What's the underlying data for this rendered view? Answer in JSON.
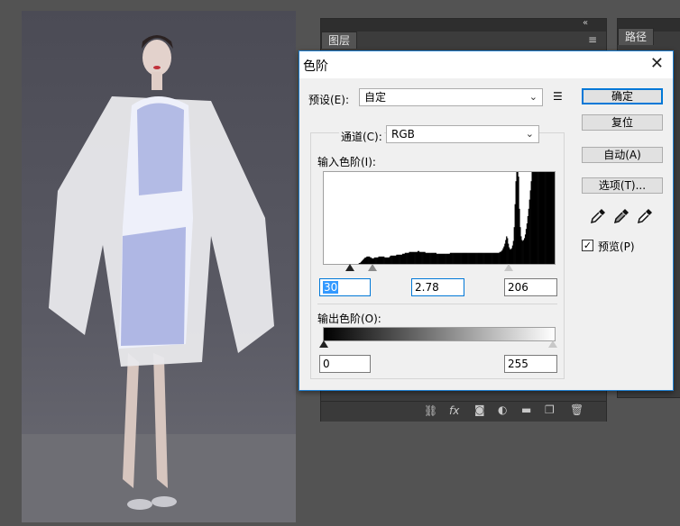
{
  "panels": {
    "layers_tab": "图层",
    "paths_tab": "路径",
    "collapse_icon": "double-chevron-left-icon",
    "menu_icon": "panel-menu-icon",
    "bottom_icons": [
      "link-icon",
      "fx-icon",
      "mask-icon",
      "adjustment-icon",
      "folder-icon",
      "new-layer-icon",
      "trash-icon"
    ],
    "fx_label": "fx"
  },
  "dialog": {
    "title": "色阶",
    "close": "✕",
    "preset_label": "预设(E):",
    "preset_value": "自定",
    "channel_label": "通道(C):",
    "channel_value": "RGB",
    "input_levels_label": "输入色阶(I):",
    "output_levels_label": "输出色阶(O):",
    "input": {
      "black": "30",
      "gamma": "2.78",
      "white": "206"
    },
    "output": {
      "black": "0",
      "white": "255"
    },
    "buttons": {
      "ok": "确定",
      "reset": "复位",
      "auto": "自动(A)",
      "options": "选项(T)..."
    },
    "preview_label": "预览(P)",
    "preview_checked": "✓",
    "eyedroppers": [
      "black-eyedropper-icon",
      "gray-eyedropper-icon",
      "white-eyedropper-icon"
    ],
    "accent": "#0078d7"
  },
  "histogram": {
    "channel": "RGB",
    "bins_0_255": [
      0,
      0,
      0,
      0,
      0,
      0,
      0,
      0,
      0,
      0,
      0,
      0,
      0,
      0,
      0,
      0,
      0,
      0,
      0,
      0,
      0,
      0,
      0,
      0,
      0,
      0,
      0,
      0,
      0,
      0,
      0,
      0,
      0,
      0,
      0,
      0,
      0,
      0,
      0,
      0,
      0,
      1,
      1,
      2,
      3,
      4,
      5,
      6,
      7,
      7,
      8,
      8,
      8,
      8,
      7,
      7,
      6,
      6,
      6,
      7,
      7,
      7,
      7,
      7,
      8,
      8,
      8,
      8,
      8,
      8,
      8,
      7,
      7,
      7,
      7,
      7,
      7,
      8,
      9,
      9,
      9,
      9,
      9,
      9,
      9,
      10,
      10,
      10,
      10,
      10,
      10,
      10,
      11,
      11,
      11,
      12,
      12,
      12,
      12,
      12,
      13,
      13,
      13,
      13,
      13,
      13,
      13,
      13,
      13,
      13,
      14,
      14,
      13,
      13,
      13,
      13,
      13,
      13,
      13,
      12,
      12,
      12,
      12,
      12,
      12,
      12,
      12,
      12,
      12,
      12,
      12,
      12,
      11,
      11,
      11,
      11,
      11,
      11,
      11,
      11,
      11,
      11,
      11,
      11,
      11,
      11,
      11,
      11,
      12,
      12,
      12,
      12,
      12,
      12,
      12,
      12,
      12,
      12,
      12,
      12,
      12,
      12,
      12,
      12,
      12,
      12,
      12,
      12,
      12,
      12,
      12,
      12,
      12,
      12,
      12,
      12,
      12,
      12,
      12,
      12,
      12,
      12,
      12,
      12,
      12,
      12,
      12,
      12,
      12,
      12,
      12,
      12,
      12,
      12,
      12,
      12,
      12,
      12,
      12,
      12,
      12,
      12,
      12,
      12,
      12,
      12,
      13,
      13,
      14,
      15,
      17,
      19,
      22,
      26,
      30,
      28,
      22,
      18,
      16,
      16,
      17,
      20,
      25,
      40,
      65,
      90,
      100,
      100,
      95,
      60,
      40,
      30,
      26,
      25,
      26,
      28,
      32,
      38,
      44,
      52,
      60,
      70,
      80,
      90,
      100,
      100,
      100,
      100,
      100,
      100,
      100,
      100,
      100,
      100,
      100,
      100,
      100,
      100,
      100,
      100,
      100,
      100,
      100,
      100,
      100,
      100,
      100,
      100,
      100,
      100,
      100
    ]
  }
}
